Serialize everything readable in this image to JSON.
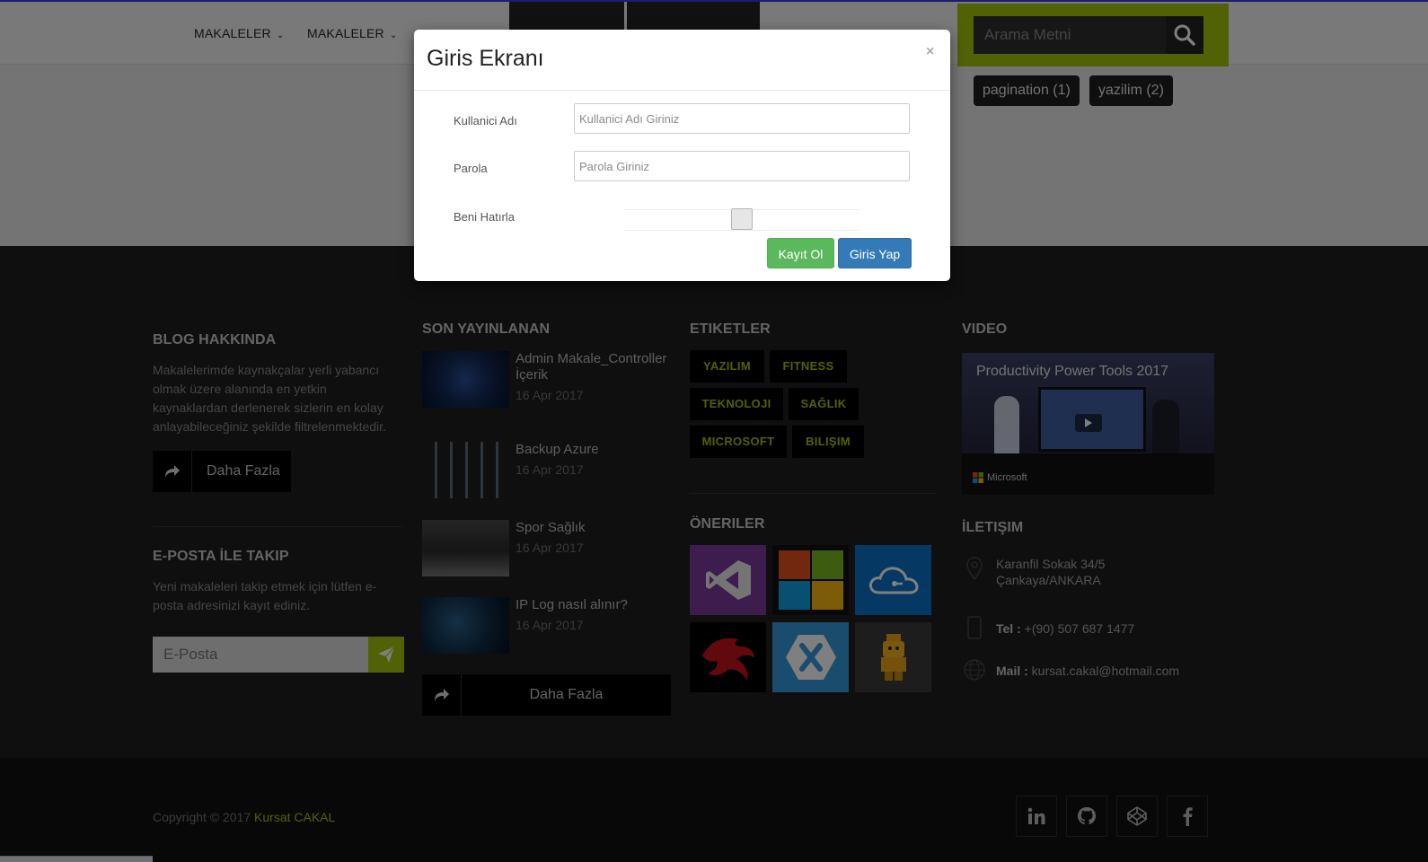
{
  "header": {
    "nav": [
      "MAKALELER",
      "MAKALELER"
    ],
    "search_placeholder": "Arama Metni",
    "tags": [
      "pagination (1)",
      "yazilim (2)"
    ]
  },
  "about": {
    "title": "BLOG HAKKINDA",
    "text": "Makalelerimde kaynakçalar yerli yabancı olmak üzere alanında en yetkin kaynaklardan derlenerek sizlerin en kolay anlayabileceğiniz şekilde filtrelenmektedir.",
    "more": "Daha Fazla"
  },
  "email_follow": {
    "title": "E-POSTA İLE TAKIP",
    "text": "Yeni makaleleri takip etmek için lütfen e-posta adresinizi kayıt ediniz.",
    "placeholder": "E-Posta"
  },
  "recent": {
    "title": "SON YAYINLANAN",
    "posts": [
      {
        "title": "Admin Makale_Controller İçerik",
        "date": "16 Apr 2017"
      },
      {
        "title": "Backup Azure",
        "date": "16 Apr 2017"
      },
      {
        "title": "Spor Sağlık",
        "date": "16 Apr 2017"
      },
      {
        "title": "IP Log nasıl alınır?",
        "date": "16 Apr 2017"
      }
    ],
    "more": "Daha Fazla"
  },
  "tags_section": {
    "title": "ETIKETLER",
    "tags": [
      "YAZILIM",
      "FITNESS",
      "TEKNOLOJI",
      "SAĞLIK",
      "MICROSOFT",
      "BILIŞIM"
    ]
  },
  "suggestions": {
    "title": "ÖNERILER",
    "tiles": [
      "visual-studio-icon",
      "windows-logo-icon",
      "azure-cloud-icon",
      "dragon-icon",
      "xamarin-icon",
      "lego-figure-icon"
    ]
  },
  "video": {
    "title": "VIDEO",
    "video_title": "Productivity Power Tools 2017",
    "brand": "Microsoft"
  },
  "contact": {
    "title": "İLETIŞIM",
    "address_line1": "Karanfil Sokak 34/5",
    "address_line2": "Çankaya/ANKARA",
    "tel_label": "Tel :",
    "tel": "+(90) 507 687 1477",
    "mail_label": "Mail :",
    "mail": "kursat.cakal@hotmail.com"
  },
  "bottom": {
    "copyright": "Copyright © 2017",
    "owner": "Kursat CAKAL",
    "social": [
      "linkedin-icon",
      "github-icon",
      "codepen-icon",
      "facebook-icon"
    ]
  },
  "modal": {
    "title": "Giris Ekranı",
    "close": "×",
    "username_label": "Kullanici Adı",
    "username_placeholder": "Kullanici Adı Giriniz",
    "password_label": "Parola",
    "password_placeholder": "Parola Giriniz",
    "remember_label": "Beni Hatırla",
    "register_button": "Kayıt Ol",
    "login_button": "Giris Yap"
  },
  "colors": {
    "accent": "#a3c20d",
    "footer_bg": "#1e1e1e",
    "primary": "#337ab7",
    "success": "#5cb85c"
  }
}
